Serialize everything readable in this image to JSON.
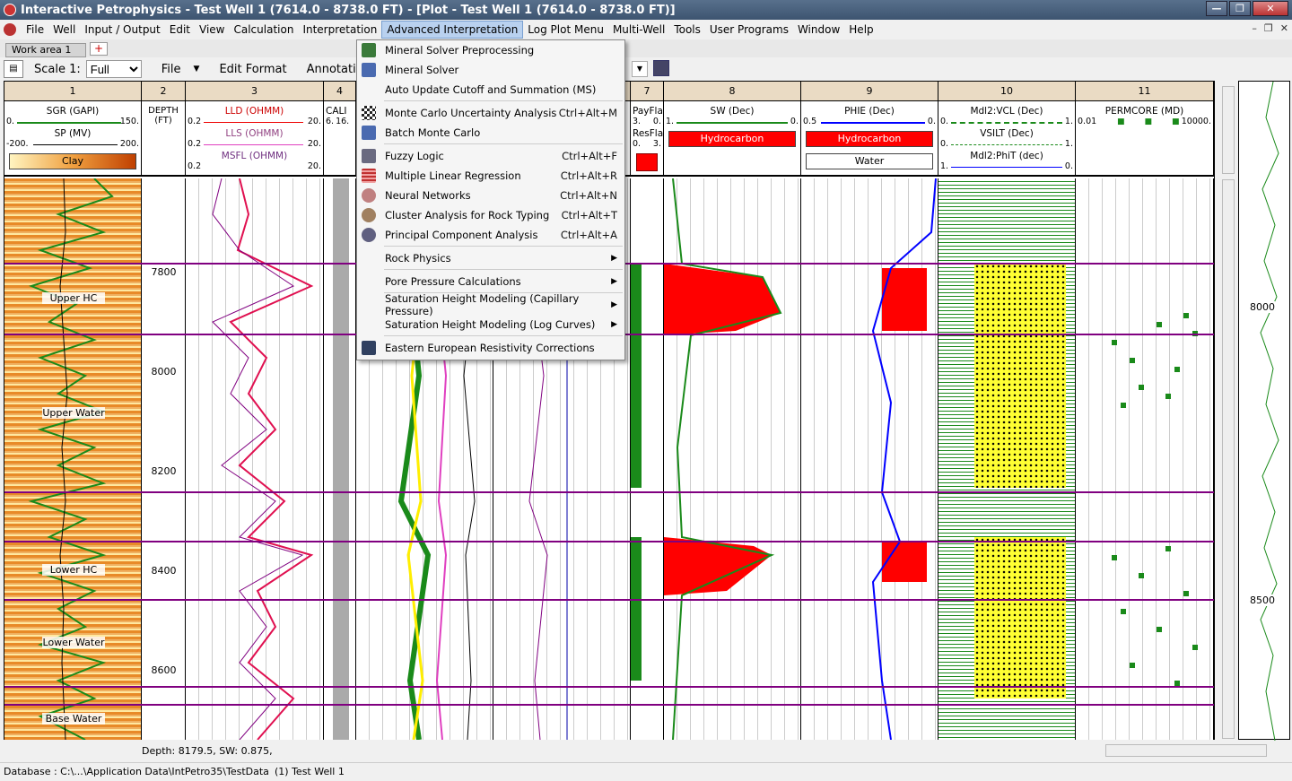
{
  "window": {
    "title": "Interactive Petrophysics  -  Test Well 1 (7614.0 - 8738.0 FT) - [Plot - Test Well 1 (7614.0 - 8738.0 FT)]",
    "buttons": [
      "—",
      "❐",
      "✕"
    ]
  },
  "menubar": {
    "items": [
      "File",
      "Well",
      "Input / Output",
      "Edit",
      "View",
      "Calculation",
      "Interpretation",
      "Advanced Interpretation",
      "Log Plot Menu",
      "Multi-Well",
      "Tools",
      "User Programs",
      "Window",
      "Help"
    ],
    "active": "Advanced Interpretation",
    "mdi_buttons": [
      "–",
      "❐",
      "✕"
    ]
  },
  "tabs": {
    "work_area": "Work area 1",
    "new_tab": "+"
  },
  "toolbar": {
    "scale_label": "Scale 1:",
    "scale_value": "Full",
    "file": "File",
    "edit_format": "Edit Format",
    "annotations": "Annotations"
  },
  "dropdown": {
    "items": [
      {
        "label": "Mineral Solver Preprocessing",
        "shortcut": "",
        "submenu": false,
        "icon": "mineral-solver-preprocessing-icon",
        "color": "#3a7a3a"
      },
      {
        "label": "Mineral Solver",
        "shortcut": "",
        "submenu": false,
        "icon": "mineral-solver-icon",
        "color": "#4a6ab0"
      },
      {
        "label": "Auto Update Cutoff and Summation (MS)",
        "shortcut": "",
        "submenu": false,
        "icon": "",
        "color": ""
      },
      {
        "label": "Monte Carlo Uncertainty Analysis",
        "shortcut": "Ctrl+Alt+M",
        "submenu": false,
        "icon": "monte-carlo-icon",
        "color": "#222222"
      },
      {
        "label": "Batch Monte Carlo",
        "shortcut": "",
        "submenu": false,
        "icon": "batch-monte-carlo-icon",
        "color": "#4a6ab0"
      },
      {
        "label": "Fuzzy Logic",
        "shortcut": "Ctrl+Alt+F",
        "submenu": false,
        "icon": "fuzzy-logic-icon",
        "color": "#6a6a80"
      },
      {
        "label": "Multiple Linear Regression",
        "shortcut": "Ctrl+Alt+R",
        "submenu": false,
        "icon": "regression-icon",
        "color": "#c03030"
      },
      {
        "label": "Neural Networks",
        "shortcut": "Ctrl+Alt+N",
        "submenu": false,
        "icon": "neural-networks-icon",
        "color": "#c08080"
      },
      {
        "label": "Cluster Analysis for Rock Typing",
        "shortcut": "Ctrl+Alt+T",
        "submenu": false,
        "icon": "cluster-analysis-icon",
        "color": "#a08060"
      },
      {
        "label": "Principal Component Analysis",
        "shortcut": "Ctrl+Alt+A",
        "submenu": false,
        "icon": "pca-icon",
        "color": "#606080"
      },
      {
        "label": "Rock Physics",
        "shortcut": "",
        "submenu": true,
        "icon": "",
        "color": ""
      },
      {
        "label": "Pore Pressure Calculations",
        "shortcut": "",
        "submenu": true,
        "icon": "",
        "color": ""
      },
      {
        "label": "Saturation Height Modeling (Capillary Pressure)",
        "shortcut": "",
        "submenu": true,
        "icon": "",
        "color": ""
      },
      {
        "label": "Saturation Height Modeling (Log Curves)",
        "shortcut": "",
        "submenu": true,
        "icon": "",
        "color": ""
      },
      {
        "label": "Eastern European Resistivity Corrections",
        "shortcut": "",
        "submenu": false,
        "icon": "resistivity-corrections-icon",
        "color": "#304060"
      }
    ]
  },
  "tracks": {
    "numbers": [
      "1",
      "2",
      "3",
      "4",
      "7",
      "8",
      "9",
      "10",
      "11"
    ],
    "t1": {
      "sgr": "SGR (GAPI)",
      "sgr_min": "0.",
      "sgr_max": "150.",
      "sp": "SP (MV)",
      "sp_min": "-200.",
      "sp_max": "200.",
      "fill": "Clay"
    },
    "t2": {
      "label": "DEPTH",
      "unit": "(FT)"
    },
    "t3": {
      "lld": "LLD (OHMM)",
      "lld_min": "0.2",
      "lld_max": "20.",
      "lls": "LLS (OHMM)",
      "lls_min": "0.2",
      "lls_max": "20.",
      "msfl": "MSFL (OHMM)",
      "msfl_min": "0.2",
      "msfl_max": "20."
    },
    "t4": {
      "cali": "CALI",
      "cali_min": "6.",
      "cali_max": "16."
    },
    "t7": {
      "payflag": "PayFla",
      "p_min": "3.",
      "p_max": "0.",
      "resflag": "ResFla",
      "r_min": "0.",
      "r_max": "3."
    },
    "t8": {
      "sw": "SW (Dec)",
      "sw_min": "1.",
      "sw_max": "0.",
      "fill": "Hydrocarbon"
    },
    "t9": {
      "phie": "PHIE (Dec)",
      "phie_min": "0.5",
      "phie_max": "0.",
      "fill1": "Hydrocarbon",
      "fill2": "Water"
    },
    "t10": {
      "vcl": "Mdl2:VCL (Dec)",
      "vcl_min": "0.",
      "vcl_max": "1.",
      "vsilt": "VSILT (Dec)",
      "vsilt_min": "0.",
      "vsilt_max": "1.",
      "phit": "Mdl2:PhiT (dec)",
      "phit_min": "1.",
      "phit_max": "0."
    },
    "t11": {
      "perm": "PERMCORE (MD)",
      "perm_min": "0.01",
      "perm_max": "10000."
    }
  },
  "depths": [
    "7800",
    "8000",
    "8200",
    "8400",
    "8600"
  ],
  "zones": [
    "Upper HC",
    "Upper Water",
    "Lower HC",
    "Lower Water",
    "Base Water"
  ],
  "mini_depths": [
    "8000",
    "8500"
  ],
  "status": {
    "readout": "Depth: 8179.5,  SW: 0.875,",
    "database": "Database : C:\\...\\Application Data\\IntPetro35\\TestData",
    "well": "(1) Test Well 1"
  },
  "colors": {
    "hydrocarbon": "#ff0000",
    "water_fill": "#ffffff",
    "clay_fill": "#e07020",
    "sand_fill": "#ffff33",
    "curve_green": "#1a8a1a",
    "zone_line": "#800080",
    "sw_blue": "#0000ff"
  }
}
